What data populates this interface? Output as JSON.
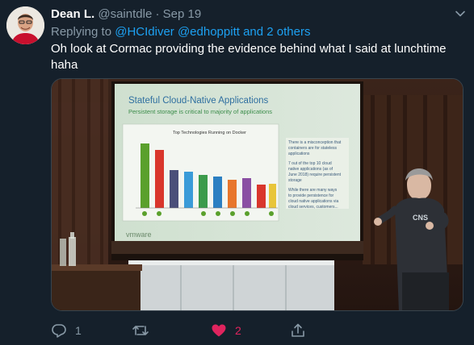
{
  "tweet": {
    "author_name": "Dean L.",
    "handle": "@saintdle",
    "separator": "·",
    "date": "Sep 19",
    "replying_prefix": "Replying to",
    "reply_mentions": "@HCIdiver @edhoppitt and 2 others",
    "text": "Oh look at Cormac providing the evidence behind what I said at lunchtime haha"
  },
  "slide": {
    "title": "Stateful Cloud-Native Applications",
    "subtitle": "Persistent storage is critical to majority of applications",
    "chart_title": "Top Technologies Running on Docker",
    "body_1": "There is a misconception that containers are for stateless applications",
    "body_2": "7 out of the top 10 cloud native applications (as of June 2018) require persistent storage",
    "body_3": "While there are many ways to provide persistence for cloud native applications via cloud services, customers are looking to use on-premises solutions to avoid cloud lock-in",
    "brand": "vmware",
    "shirt": "CNS"
  },
  "actions": {
    "reply_count": "1",
    "retweet_count": "",
    "like_count": "2",
    "share_count": ""
  },
  "colors": {
    "background": "#15202b",
    "muted": "#8899a6",
    "link": "#1da1f2",
    "like": "#e0245e"
  },
  "icons": [
    "caret-down-icon",
    "reply-icon",
    "retweet-icon",
    "heart-icon",
    "share-icon"
  ]
}
